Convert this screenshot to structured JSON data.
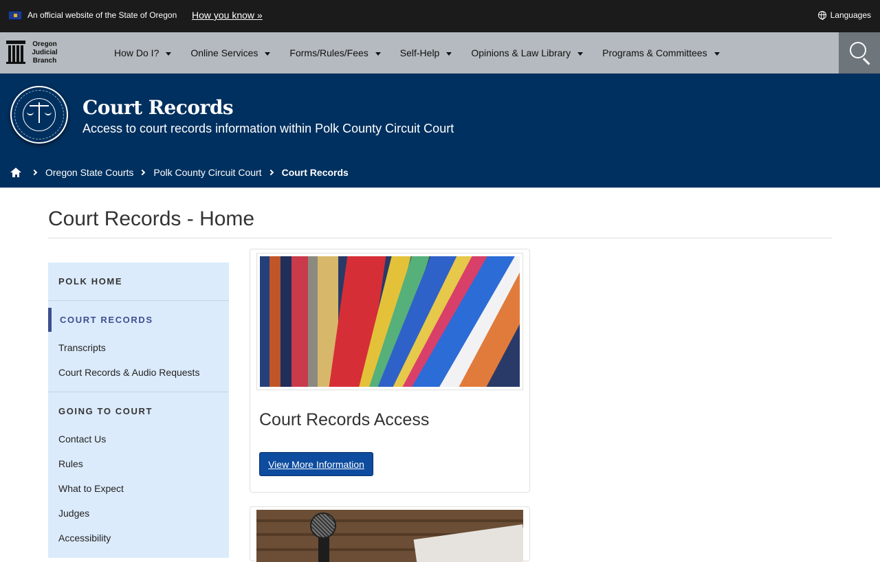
{
  "banner": {
    "official_text": "An official website of the State of Oregon",
    "how_you_know": "How you know »",
    "languages": "Languages"
  },
  "logo": {
    "line1": "Oregon",
    "line2": "Judicial",
    "line3": "Branch"
  },
  "nav": {
    "items": [
      {
        "label": "How Do I?"
      },
      {
        "label": "Online Services"
      },
      {
        "label": "Forms/Rules/Fees"
      },
      {
        "label": "Self-Help"
      },
      {
        "label": "Opinions & Law Library"
      },
      {
        "label": "Programs & Committees"
      }
    ],
    "search_icon": "search-icon"
  },
  "hero": {
    "title": "Court Records",
    "subtitle": "Access to court records information within Polk County Circuit Court"
  },
  "breadcrumb": {
    "items": [
      {
        "label": "Oregon State Courts"
      },
      {
        "label": "Polk County Circuit Court"
      }
    ],
    "current": "Court Records"
  },
  "page": {
    "title": "Court Records - Home"
  },
  "sidebar": {
    "polk_home": "POLK HOME",
    "court_records": "COURT RECORDS",
    "court_records_links": [
      {
        "label": "Transcripts"
      },
      {
        "label": "Court Records & Audio Requests"
      }
    ],
    "going_to_court": "GOING TO COURT",
    "going_links": [
      {
        "label": "Contact Us"
      },
      {
        "label": "Rules"
      },
      {
        "label": "What to Expect"
      },
      {
        "label": "Judges"
      },
      {
        "label": "Accessibility"
      }
    ]
  },
  "cards": [
    {
      "title": "Court Records Access",
      "button": "View More Information"
    }
  ],
  "colors": {
    "banner_bg": "#1b1b1b",
    "nav_bg": "#b4babf",
    "hero_bg": "#00305f",
    "sidebar_bg": "#dcebfb",
    "button_bg": "#0d4c9e"
  }
}
